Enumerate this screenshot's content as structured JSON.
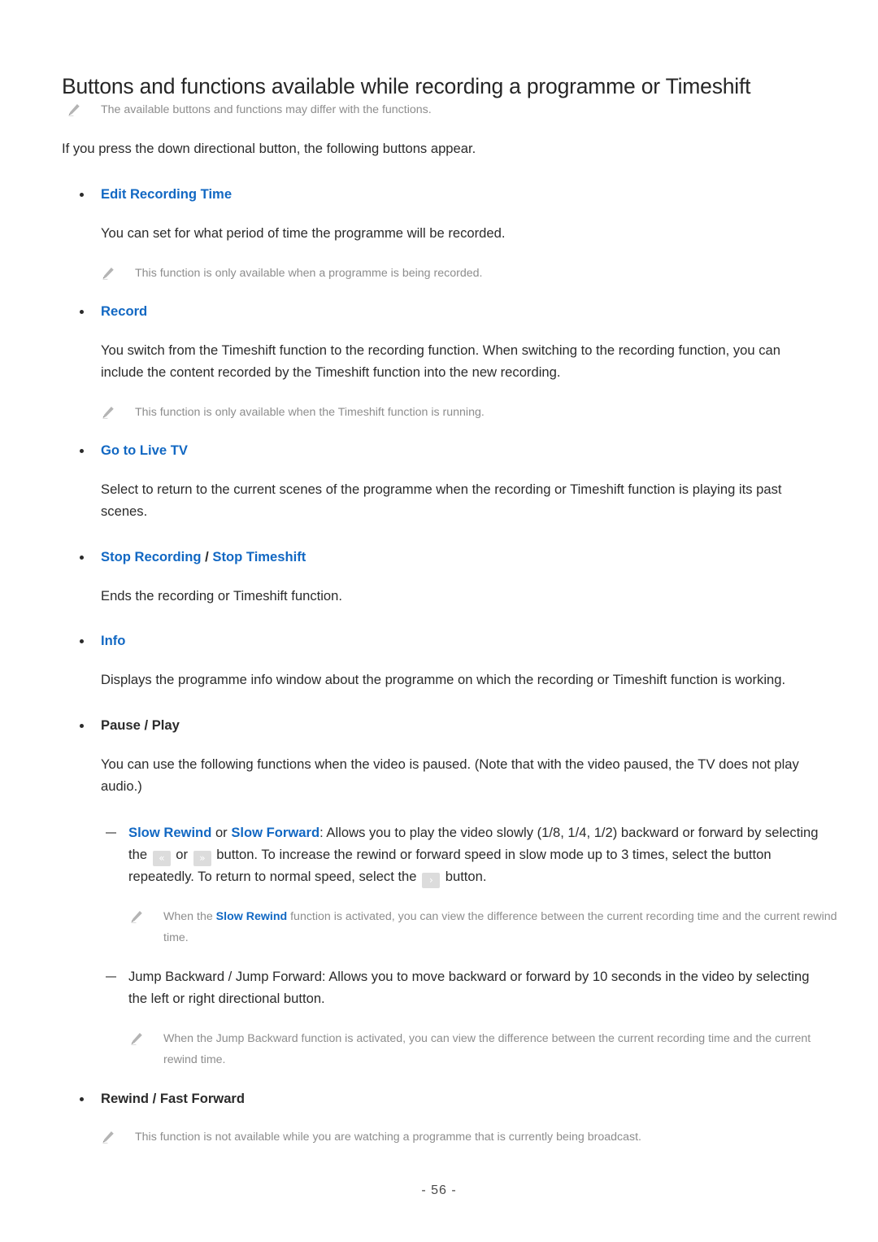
{
  "document": {
    "title": "Buttons and functions available while recording a programme or Timeshift",
    "page_number": "- 56 -"
  },
  "colors": {
    "link_blue": "#1268c3",
    "body_text": "#2b2b2b",
    "note_text": "#8d8d8d",
    "key_button_bg": "#dcdcdc"
  },
  "intro": {
    "note": "The available buttons and functions may differ with the functions.",
    "paragraph": "If you press the down directional button, the following buttons appear."
  },
  "sections": {
    "edit_recording_time": {
      "heading": "Edit Recording Time",
      "body": "You can set for what period of time the programme will be recorded.",
      "note": "This function is only available when a programme is being recorded."
    },
    "record": {
      "heading": "Record",
      "body": "You switch from the Timeshift function to the recording function. When switching to the recording function, you can include the content recorded by the Timeshift function into the new recording.",
      "note": "This function is only available when the Timeshift function is running."
    },
    "go_to_live_tv": {
      "heading": "Go to Live TV",
      "body": "Select to return to the current scenes of the programme when the recording or Timeshift function is playing its past scenes."
    },
    "stop_recording": {
      "heading_part1": "Stop Recording",
      "heading_separator": " / ",
      "heading_part2": "Stop Timeshift",
      "body": "Ends the recording or Timeshift function."
    },
    "info": {
      "heading": "Info",
      "body": "Displays the programme info window about the programme on which the recording or Timeshift function is working."
    },
    "pause_play": {
      "heading": "Pause / Play",
      "body": "You can use the following functions when the video is paused. (Note that with the video paused, the TV does not play audio.)",
      "slow": {
        "term1": "Slow Rewind",
        "term_joiner": " or ",
        "term2": "Slow Forward",
        "text_a": ": Allows you to play the video slowly (1/8, 1/4, 1/2) backward or forward by selecting the ",
        "key_rewind": "«",
        "text_b": " or ",
        "key_forward": "»",
        "text_c": " button. To increase the rewind or forward speed in slow mode up to 3 times, select the button repeatedly. To return to normal speed, select the ",
        "key_play": "›",
        "text_d": " button.",
        "note_a": "When the ",
        "note_link": "Slow Rewind",
        "note_b": " function is activated, you can view the difference between the current recording time and the current rewind time."
      },
      "jump": {
        "text": "Jump Backward / Jump Forward: Allows you to move backward or forward by 10 seconds in the video by selecting the left or right directional button.",
        "note": "When the Jump Backward function is activated, you can view the difference between the current recording time and the current rewind time."
      }
    },
    "rewind_fast_forward": {
      "heading": "Rewind / Fast Forward",
      "note": "This function is not available while you are watching a programme that is currently being broadcast."
    }
  },
  "icons": {
    "note": "pencil-icon",
    "bullet": "bullet-dot-icon",
    "dash": "dash-icon"
  }
}
